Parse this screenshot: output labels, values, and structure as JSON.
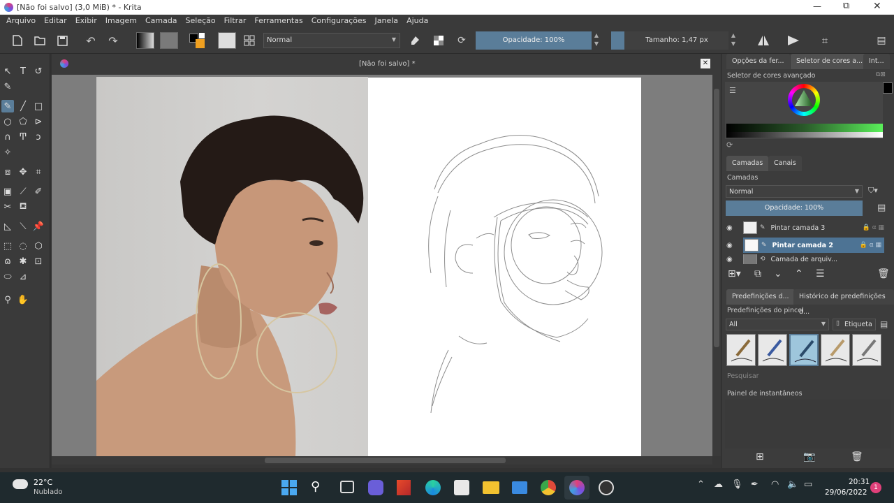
{
  "window": {
    "title": "[Não foi salvo]  (3,0 MiB)  * - Krita",
    "controls": [
      "—",
      "⧉",
      "✕"
    ]
  },
  "menu": [
    "Arquivo",
    "Editar",
    "Exibir",
    "Imagem",
    "Camada",
    "Seleção",
    "Filtrar",
    "Ferramentas",
    "Configurações",
    "Janela",
    "Ajuda"
  ],
  "toolbar": {
    "blend_mode": "Normal",
    "opacity": "Opacidade: 100%",
    "size": "Tamanho: 1,47 px"
  },
  "document": {
    "tab_title": "[Não foi salvo]  *"
  },
  "dock": {
    "top_tabs": [
      "Opções da fer...",
      "Seletor de cores a...",
      "Int..."
    ],
    "color_selector_title": "Seletor de cores avançado",
    "layers_tabs": [
      "Camadas",
      "Canais"
    ],
    "layers_title": "Camadas",
    "layer_blend": "Normal",
    "layer_opacity": "Opacidade:  100%",
    "layers": [
      "Pintar camada 3",
      "Pintar camada 2",
      "Camada de arquiv..."
    ],
    "presets_tabs": [
      "Predefinições d...",
      "Histórico de predefinições d..."
    ],
    "presets_title": "Predefinições do pincel",
    "preset_filter": "All",
    "preset_tag": "Etiqueta",
    "search_placeholder": "Pesquisar",
    "snapshot_title": "Painel de instantâneos"
  },
  "taskbar": {
    "weather_temp": "22°C",
    "weather_desc": "Nublado",
    "time": "20:31",
    "date": "29/06/2022",
    "notification_count": "1"
  },
  "colors": {
    "accent": "#5a7d99",
    "selected_layer": "#4d7394",
    "background": "#323232"
  }
}
